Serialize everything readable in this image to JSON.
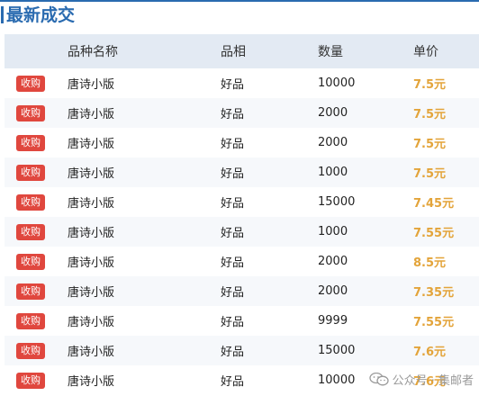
{
  "title": "最新成交",
  "headers": {
    "name": "品种名称",
    "grade": "品相",
    "quantity": "数量",
    "price": "单价"
  },
  "rows": [
    {
      "tag": "收购",
      "name": "唐诗小版",
      "grade": "好品",
      "quantity": "10000",
      "price": "7.5元"
    },
    {
      "tag": "收购",
      "name": "唐诗小版",
      "grade": "好品",
      "quantity": "2000",
      "price": "7.5元"
    },
    {
      "tag": "收购",
      "name": "唐诗小版",
      "grade": "好品",
      "quantity": "2000",
      "price": "7.5元"
    },
    {
      "tag": "收购",
      "name": "唐诗小版",
      "grade": "好品",
      "quantity": "1000",
      "price": "7.5元"
    },
    {
      "tag": "收购",
      "name": "唐诗小版",
      "grade": "好品",
      "quantity": "15000",
      "price": "7.45元"
    },
    {
      "tag": "收购",
      "name": "唐诗小版",
      "grade": "好品",
      "quantity": "1000",
      "price": "7.55元"
    },
    {
      "tag": "收购",
      "name": "唐诗小版",
      "grade": "好品",
      "quantity": "2000",
      "price": "8.5元"
    },
    {
      "tag": "收购",
      "name": "唐诗小版",
      "grade": "好品",
      "quantity": "2000",
      "price": "7.35元"
    },
    {
      "tag": "收购",
      "name": "唐诗小版",
      "grade": "好品",
      "quantity": "9999",
      "price": "7.55元"
    },
    {
      "tag": "收购",
      "name": "唐诗小版",
      "grade": "好品",
      "quantity": "15000",
      "price": "7.6元"
    },
    {
      "tag": "收购",
      "name": "唐诗小版",
      "grade": "好品",
      "quantity": "10000",
      "price": "7.6元"
    }
  ],
  "watermark": {
    "text": "公众号 · 集邮者",
    "icon": "wechat-icon"
  },
  "colors": {
    "accent": "#2a6bb0",
    "badge": "#e0473e",
    "price": "#e3a43a",
    "header_bg": "#e3eaf3"
  }
}
